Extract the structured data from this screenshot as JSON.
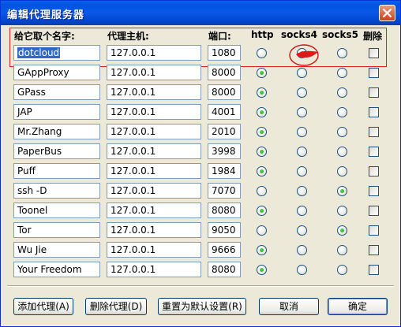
{
  "window": {
    "title": "编辑代理服务器"
  },
  "headers": {
    "name": "给它取个名字:",
    "host": "代理主机:",
    "port": "端口:",
    "http": "http",
    "socks4": "socks4",
    "socks5": "socks5",
    "delete": "删除"
  },
  "rows": [
    {
      "name": "dotcloud",
      "host": "127.0.0.1",
      "port": "1080",
      "protocol": "socks4",
      "delete": false
    },
    {
      "name": "GAppProxy",
      "host": "127.0.0.1",
      "port": "8000",
      "protocol": "http",
      "delete": false
    },
    {
      "name": "GPass",
      "host": "127.0.0.1",
      "port": "8000",
      "protocol": "http",
      "delete": false
    },
    {
      "name": "JAP",
      "host": "127.0.0.1",
      "port": "4001",
      "protocol": "http",
      "delete": false
    },
    {
      "name": "Mr.Zhang",
      "host": "127.0.0.1",
      "port": "2010",
      "protocol": "http",
      "delete": false
    },
    {
      "name": "PaperBus",
      "host": "127.0.0.1",
      "port": "3998",
      "protocol": "http",
      "delete": false
    },
    {
      "name": "Puff",
      "host": "127.0.0.1",
      "port": "1984",
      "protocol": "http",
      "delete": false
    },
    {
      "name": "ssh -D",
      "host": "127.0.0.1",
      "port": "7070",
      "protocol": "socks5",
      "delete": false
    },
    {
      "name": "Toonel",
      "host": "127.0.0.1",
      "port": "8080",
      "protocol": "http",
      "delete": false
    },
    {
      "name": "Tor",
      "host": "127.0.0.1",
      "port": "9050",
      "protocol": "socks5",
      "delete": false
    },
    {
      "name": "Wu Jie",
      "host": "127.0.0.1",
      "port": "9666",
      "protocol": "http",
      "delete": false
    },
    {
      "name": "Your Freedom",
      "host": "127.0.0.1",
      "port": "8080",
      "protocol": "http",
      "delete": false
    }
  ],
  "buttons": {
    "add": "添加代理(A)",
    "remove": "删除代理(D)",
    "reset": "重置为默认设置(R)",
    "cancel": "取消",
    "ok": "确定"
  },
  "icons": {
    "close": "close-icon"
  },
  "colors": {
    "title_bar": "#0053e0",
    "highlight_border": "#e02020",
    "selection": "#316ac5",
    "radio_checked": "#21a121"
  }
}
